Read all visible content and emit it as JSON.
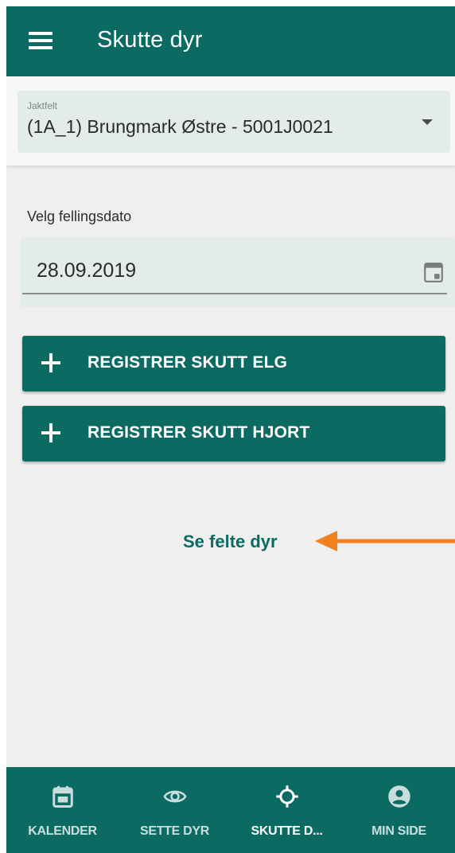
{
  "appbar": {
    "title": "Skutte dyr",
    "menu_icon": "menu-icon"
  },
  "hunting_field": {
    "label": "Jaktfelt",
    "value": "(1A_1) Brungmark Østre - 5001J0021",
    "icon": "dropdown-arrow-icon"
  },
  "date": {
    "label": "Velg fellingsdato",
    "value": "28.09.2019",
    "icon": "calendar-icon"
  },
  "buttons": {
    "register_elg": "REGISTRER SKUTT ELG",
    "register_hjort": "REGISTRER SKUTT HJORT"
  },
  "link": {
    "see_felled": "Se felte dyr"
  },
  "annotation": {
    "arrow_color": "#f2811d"
  },
  "bottom_nav": {
    "items": [
      {
        "label": "KALENDER",
        "icon": "calendar-icon"
      },
      {
        "label": "SETTE DYR",
        "icon": "eye-icon"
      },
      {
        "label": "SKUTTE D...",
        "icon": "crosshair-icon",
        "active": true
      },
      {
        "label": "MIN SIDE",
        "icon": "account-icon"
      }
    ]
  },
  "colors": {
    "primary": "#0b6b62",
    "background": "#efefef",
    "field": "#e4ebeb"
  }
}
